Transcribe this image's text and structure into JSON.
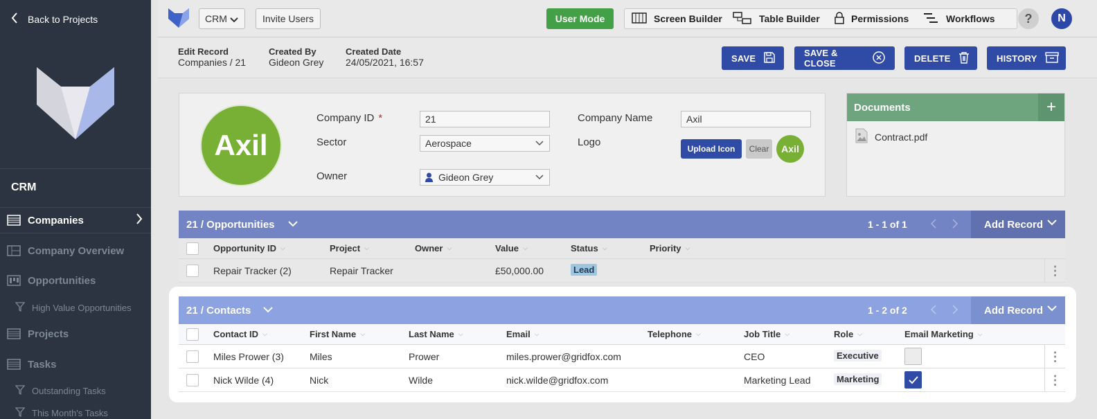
{
  "sidebar": {
    "back_label": "Back to Projects",
    "app_title": "CRM",
    "items": [
      {
        "label": "Companies",
        "icon": "table-icon"
      },
      {
        "label": "Company Overview",
        "icon": "layout-icon"
      },
      {
        "label": "Opportunities",
        "icon": "kanban-icon"
      },
      {
        "label": "High Value Opportunities",
        "icon": "filter-icon"
      },
      {
        "label": "Projects",
        "icon": "table-icon"
      },
      {
        "label": "Tasks",
        "icon": "table-icon"
      },
      {
        "label": "Outstanding Tasks",
        "icon": "filter-icon"
      },
      {
        "label": "This Month's Tasks",
        "icon": "filter-icon"
      }
    ]
  },
  "topbar": {
    "project_select": "CRM",
    "invite_label": "Invite Users",
    "user_mode_label": "User Mode",
    "tools": [
      "Screen Builder",
      "Table Builder",
      "Permissions",
      "Workflows"
    ],
    "help_label": "?",
    "avatar_initial": "N"
  },
  "record": {
    "edit_label": "Edit Record",
    "edit_value": "Companies / 21",
    "created_by_label": "Created By",
    "created_by_value": "Gideon Grey",
    "created_date_label": "Created Date",
    "created_date_value": "24/05/2021, 16:57",
    "actions": [
      "SAVE",
      "SAVE & CLOSE",
      "DELETE",
      "HISTORY"
    ]
  },
  "form": {
    "avatar_text": "Axil",
    "company_id_label": "Company ID",
    "required_mark": "*",
    "company_id_value": "21",
    "sector_label": "Sector",
    "sector_value": "Aerospace",
    "owner_label": "Owner",
    "owner_value": "Gideon Grey",
    "company_name_label": "Company Name",
    "company_name_value": "Axil",
    "logo_label": "Logo",
    "upload_label": "Upload Icon",
    "clear_label": "Clear",
    "logo_text": "Axil"
  },
  "documents": {
    "title": "Documents",
    "add_label": "+",
    "files": [
      "Contract.pdf"
    ]
  },
  "opportunities": {
    "title": "21 / Opportunities",
    "pagination": "1 - 1 of 1",
    "add_label": "Add Record",
    "columns": [
      "Opportunity ID",
      "Project",
      "Owner",
      "Value",
      "Status",
      "Priority"
    ],
    "rows": [
      {
        "id": "Repair Tracker (2)",
        "project": "Repair Tracker",
        "owner": "",
        "value": "£50,000.00",
        "status": "Lead",
        "priority": ""
      }
    ]
  },
  "contacts": {
    "title": "21 / Contacts",
    "pagination": "1 - 2 of 2",
    "add_label": "Add Record",
    "columns": [
      "Contact ID",
      "First Name",
      "Last Name",
      "Email",
      "Telephone",
      "Job Title",
      "Role",
      "Email Marketing"
    ],
    "rows": [
      {
        "id": "Miles Prower (3)",
        "first": "Miles",
        "last": "Prower",
        "email": "miles.prower@gridfox.com",
        "telephone": "",
        "job": "CEO",
        "role": "Executive",
        "marketing": false
      },
      {
        "id": "Nick Wilde (4)",
        "first": "Nick",
        "last": "Wilde",
        "email": "nick.wilde@gridfox.com",
        "telephone": "",
        "job": "Marketing Lead",
        "role": "Marketing",
        "marketing": true
      }
    ]
  },
  "colors": {
    "sidebar_bg": "#2b3440",
    "accent_blue": "#2f4ba5",
    "green": "#43a047",
    "opp_header": "#7384c4",
    "contacts_header": "#8da2e0",
    "docs_header": "#6ea57f"
  }
}
